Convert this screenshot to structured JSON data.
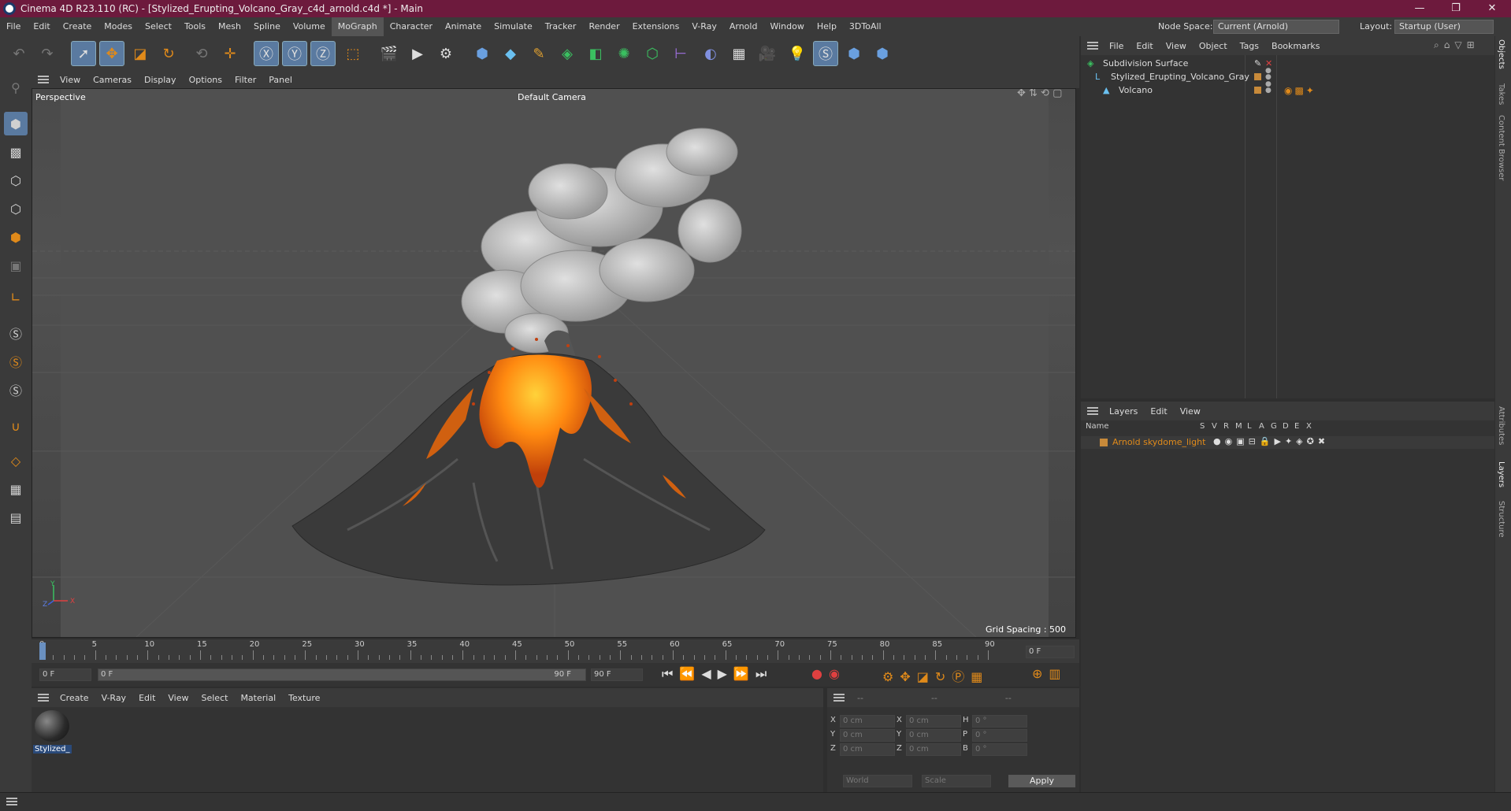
{
  "window": {
    "title": "Cinema 4D R23.110 (RC) - [Stylized_Erupting_Volcano_Gray_c4d_arnold.c4d *] - Main",
    "min": "—",
    "max": "❐",
    "close": "✕"
  },
  "menu": [
    "File",
    "Edit",
    "Create",
    "Modes",
    "Select",
    "Tools",
    "Mesh",
    "Spline",
    "Volume",
    "MoGraph",
    "Character",
    "Animate",
    "Simulate",
    "Tracker",
    "Render",
    "Extensions",
    "V-Ray",
    "Arnold",
    "Window",
    "Help",
    "3DToAll"
  ],
  "node_space": {
    "label": "Node Space:",
    "value": "Current (Arnold)"
  },
  "layout": {
    "label": "Layout:",
    "value": "Startup (User)"
  },
  "viewport": {
    "menu": [
      "View",
      "Cameras",
      "Display",
      "Options",
      "Filter",
      "Panel"
    ],
    "label": "Perspective",
    "camera": "Default Camera",
    "grid_spacing": "Grid Spacing : 500 cm",
    "axes": {
      "y": "Y",
      "z": "Z",
      "x": "X"
    }
  },
  "timeline": {
    "ticks": [
      "0",
      "5",
      "10",
      "15",
      "20",
      "25",
      "30",
      "35",
      "40",
      "45",
      "50",
      "55",
      "60",
      "65",
      "70",
      "75",
      "80",
      "85",
      "90"
    ],
    "frame_right": "0 F"
  },
  "transport": {
    "start": "0 F",
    "current": "0 F",
    "end_inner": "90 F",
    "end": "90 F"
  },
  "material_panel": {
    "menu": [
      "Create",
      "V-Ray",
      "Edit",
      "View",
      "Select",
      "Material",
      "Texture"
    ],
    "material_name": "Stylized_"
  },
  "coords": {
    "headers": [
      "--",
      "--",
      "--"
    ],
    "rows": [
      {
        "a": "X",
        "av": "0 cm",
        "b": "X",
        "bv": "0 cm",
        "c": "H",
        "cv": "0 °"
      },
      {
        "a": "Y",
        "av": "0 cm",
        "b": "Y",
        "bv": "0 cm",
        "c": "P",
        "cv": "0 °"
      },
      {
        "a": "Z",
        "av": "0 cm",
        "b": "Z",
        "bv": "0 cm",
        "c": "B",
        "cv": "0 °"
      }
    ],
    "world": "World",
    "scale": "Scale",
    "apply": "Apply"
  },
  "objects_panel": {
    "menu": [
      "File",
      "Edit",
      "View",
      "Object",
      "Tags",
      "Bookmarks"
    ],
    "items": [
      {
        "name": "Subdivision Surface",
        "indent": 0
      },
      {
        "name": "Stylized_Erupting_Volcano_Gray",
        "indent": 1
      },
      {
        "name": "Volcano",
        "indent": 2
      }
    ]
  },
  "layers_panel": {
    "menu": [
      "Layers",
      "Edit",
      "View"
    ],
    "columns": [
      "Name",
      "S",
      "V",
      "R",
      "M",
      "L",
      "A",
      "G",
      "D",
      "E",
      "X"
    ],
    "layer": "Arnold skydome_light"
  },
  "right_tabs": [
    "Objects",
    "Takes",
    "Content Browser",
    "Attributes",
    "Layers",
    "Structure"
  ],
  "colors": {
    "title": "#6d1a3d",
    "accent": "#e08a1a",
    "highlight": "#5a7aa0"
  }
}
